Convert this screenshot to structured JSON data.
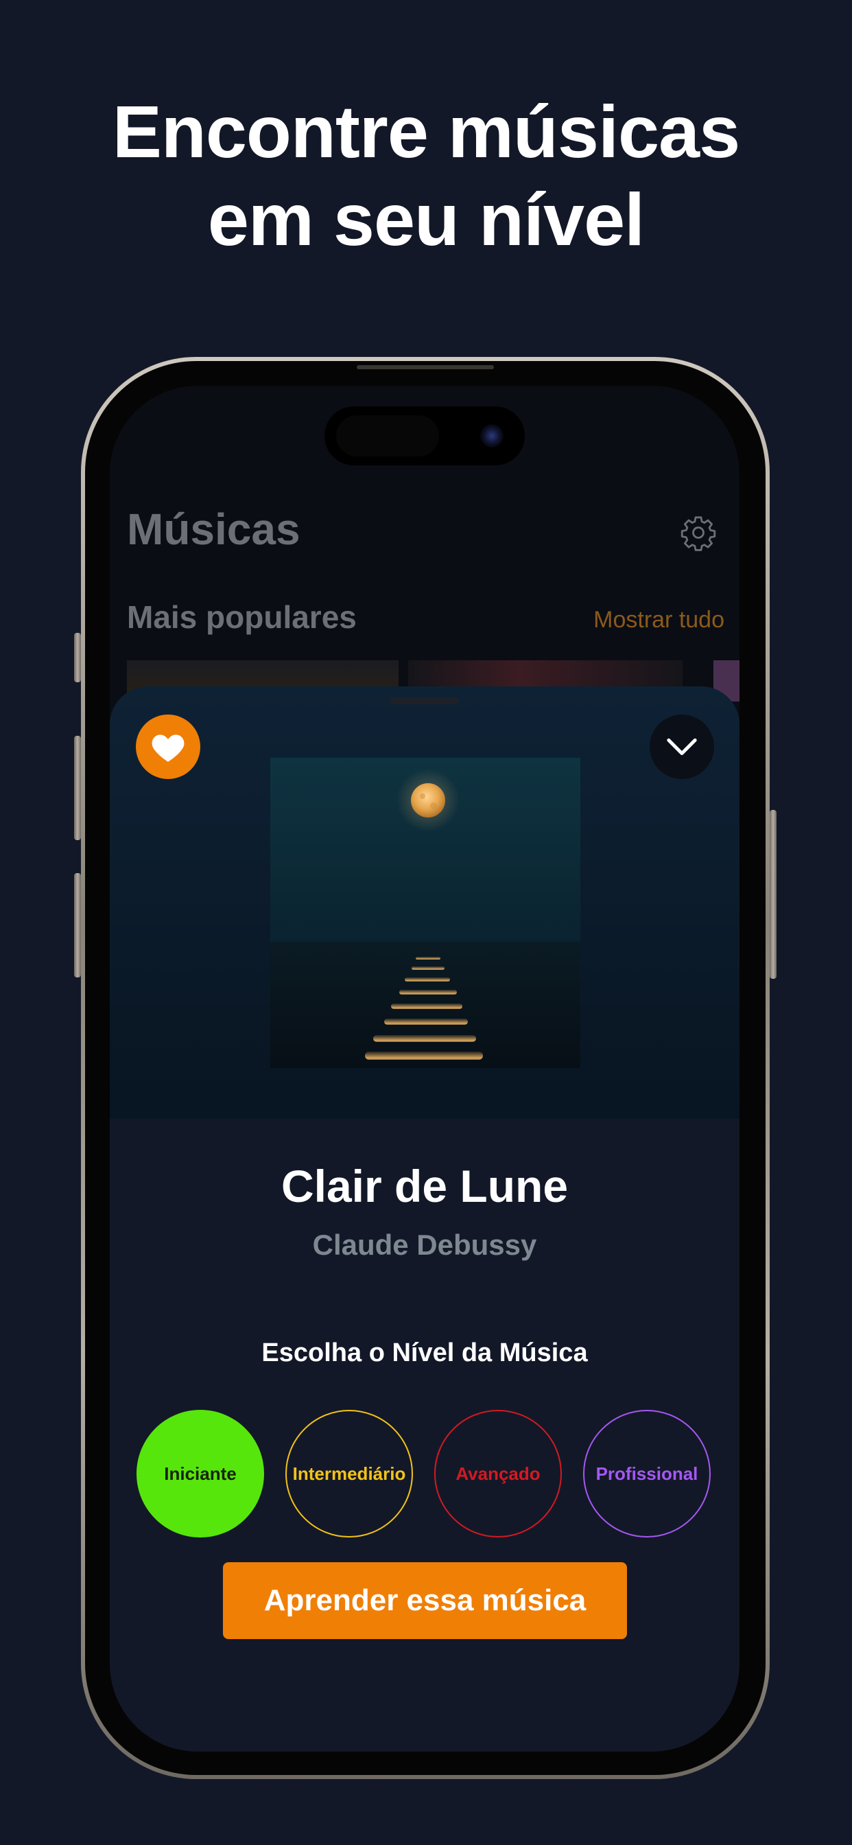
{
  "headline": {
    "line1": "Encontre músicas",
    "line2": "em seu nível"
  },
  "app": {
    "title": "Músicas",
    "settings_icon": "gear-icon",
    "section_title": "Mais populares",
    "show_all_label": "Mostrar tudo"
  },
  "song": {
    "title": "Clair de Lune",
    "artist": "Claude Debussy",
    "favorite_icon": "heart-icon",
    "collapse_icon": "chevron-down-icon",
    "artwork": "moon-over-sea-artwork"
  },
  "level_picker": {
    "prompt": "Escolha o Nível da Música",
    "levels": [
      {
        "label": "Iniciante",
        "color": "#57e60c",
        "selected": true
      },
      {
        "label": "Intermediário",
        "color": "#f2c31a",
        "selected": false
      },
      {
        "label": "Avançado",
        "color": "#d21a22",
        "selected": false
      },
      {
        "label": "Profissional",
        "color": "#a458f2",
        "selected": false
      }
    ]
  },
  "cta": {
    "label": "Aprender essa música"
  },
  "colors": {
    "background": "#131828",
    "accent": "#f07f06",
    "artist_text": "#7d8891"
  }
}
